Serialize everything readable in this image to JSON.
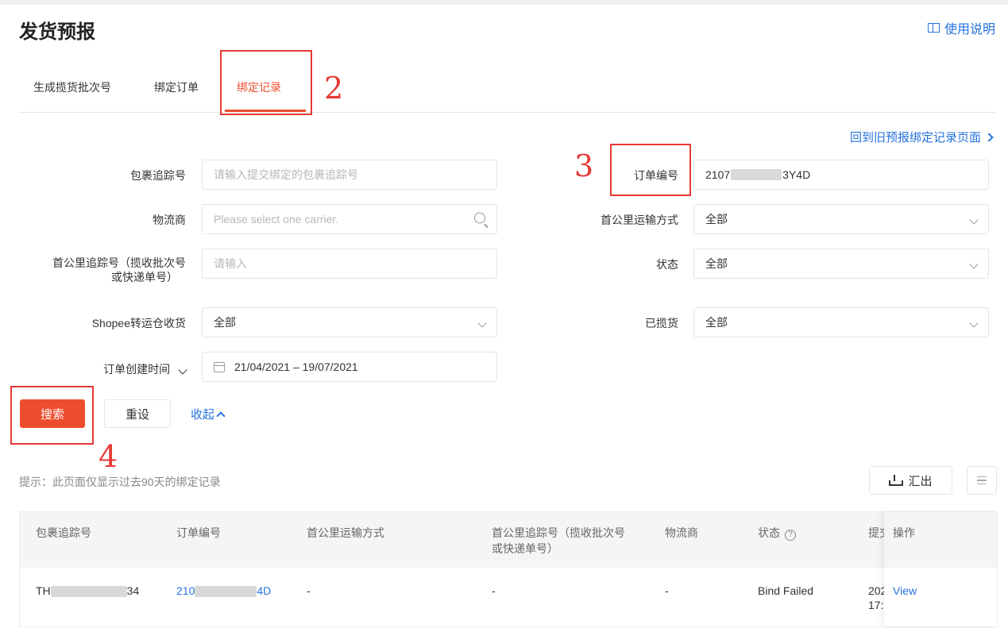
{
  "page": {
    "title": "发货预报",
    "guide_link": "使用说明"
  },
  "tabs": [
    {
      "label": "生成揽货批次号"
    },
    {
      "label": "绑定订单"
    },
    {
      "label": "绑定记录"
    }
  ],
  "annotations": [
    "2",
    "3",
    "4"
  ],
  "back_link": "回到旧预报绑定记录页面",
  "filters": {
    "tracking_label": "包裹追踪号",
    "tracking_placeholder": "请输入提交绑定的包裹追踪号",
    "carrier_label": "物流商",
    "carrier_placeholder": "Please select one carrier.",
    "firstmile_tracking_label_1": "首公里追踪号（揽收批次号",
    "firstmile_tracking_label_2": "或快递单号）",
    "firstmile_tracking_placeholder": "请输入",
    "shopee_warehouse_label": "Shopee转运仓收货",
    "shopee_warehouse_value": "全部",
    "order_created_label": "订单创建时间",
    "date_range": "21/04/2021 – 19/07/2021",
    "order_no_label": "订单编号",
    "order_no_prefix": "2107",
    "order_no_suffix": "3Y4D",
    "firstmile_method_label": "首公里运输方式",
    "firstmile_method_value": "全部",
    "status_label": "状态",
    "status_value": "全部",
    "picked_label": "已揽货",
    "picked_value": "全部"
  },
  "buttons": {
    "search": "搜索",
    "reset": "重设",
    "collapse": "收起",
    "export": "汇出"
  },
  "hint": "提示：此页面仅显示过去90天的绑定记录",
  "table": {
    "headers": {
      "tracking": "包裹追踪号",
      "order_no": "订单编号",
      "fm_method": "首公里运输方式",
      "fm_tracking_1": "首公里追踪号（揽收批次号",
      "fm_tracking_2": "或快递单号）",
      "carrier": "物流商",
      "status": "状态",
      "submit": "提交",
      "action": "操作"
    },
    "rows": [
      {
        "tracking_prefix": "TH",
        "tracking_suffix": "34",
        "order_prefix": "210",
        "order_suffix": "4D",
        "fm_method": "-",
        "fm_tracking": "-",
        "carrier": "-",
        "status": "Bind Failed",
        "submit_1": "202",
        "submit_2": "17:",
        "action": "View"
      }
    ]
  }
}
